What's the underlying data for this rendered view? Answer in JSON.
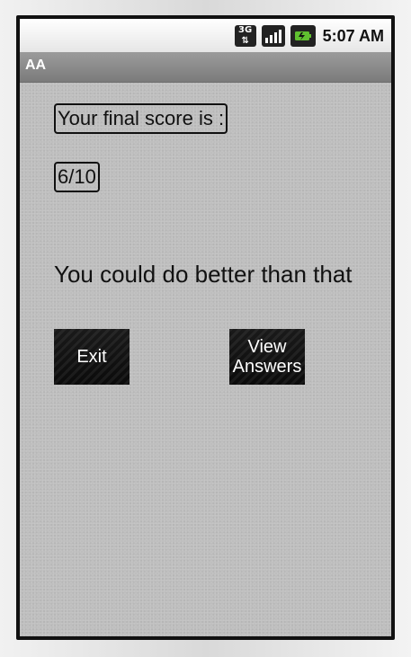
{
  "status_bar": {
    "network_label": "3G",
    "time": "5:07 AM",
    "icons": [
      "network-3g-icon",
      "signal-bars-icon",
      "battery-charging-icon"
    ]
  },
  "app_bar": {
    "title": "AA"
  },
  "main": {
    "score_label": "Your final score is :",
    "score_value": "6/10",
    "feedback": "You could do better than that",
    "buttons": {
      "exit": "Exit",
      "view_answers_line1": "View",
      "view_answers_line2": "Answers"
    }
  },
  "colors": {
    "title_bar": "#8a8a8a",
    "content_bg": "#bebebe",
    "button_bg": "#121212",
    "battery_green": "#5fbf2f"
  }
}
